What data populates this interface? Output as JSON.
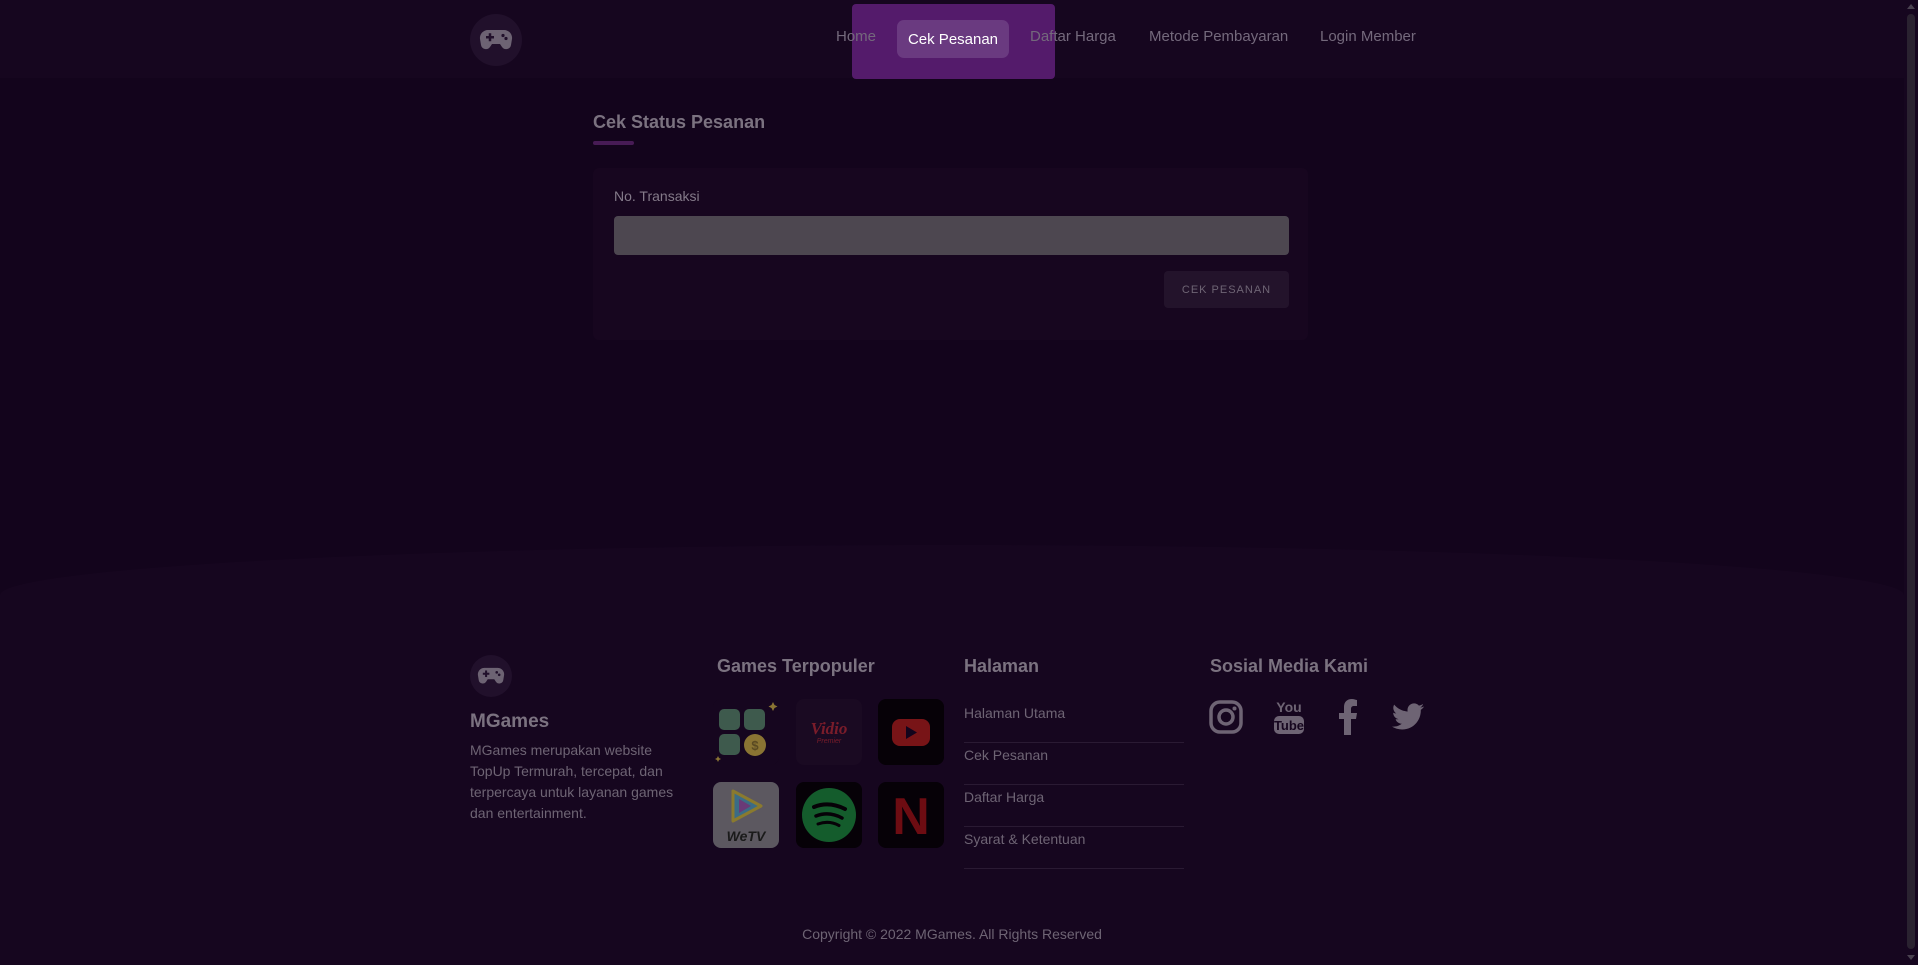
{
  "nav": {
    "logo_icon": "gamepad-icon",
    "items": [
      {
        "label": "Home",
        "active": false
      },
      {
        "label": "Cek Pesanan",
        "active": true
      },
      {
        "label": "Daftar Harga",
        "active": false
      },
      {
        "label": "Metode Pembayaran",
        "active": false
      },
      {
        "label": "Login Member",
        "active": false
      }
    ]
  },
  "main": {
    "title": "Cek Status Pesanan",
    "form": {
      "label": "No. Transaksi",
      "value": "",
      "placeholder": "",
      "button_label": "CEK PESANAN"
    }
  },
  "footer": {
    "brand": {
      "name": "MGames",
      "description": "MGames merupakan website TopUp Termurah, tercepat, dan terpercaya untuk layanan games dan entertainment."
    },
    "games": {
      "title": "Games Terpopuler",
      "tiles": [
        {
          "name": "apps-coins",
          "text": ""
        },
        {
          "name": "vidio-premier",
          "text": "Vidio",
          "subtext": "Premier"
        },
        {
          "name": "youtube",
          "text": ""
        },
        {
          "name": "wetv",
          "text": "WeTV"
        },
        {
          "name": "spotify",
          "text": ""
        },
        {
          "name": "netflix",
          "text": "N"
        }
      ]
    },
    "pages": {
      "title": "Halaman",
      "links": [
        "Halaman Utama",
        "Cek Pesanan",
        "Daftar Harga",
        "Syarat & Ketentuan"
      ]
    },
    "social": {
      "title": "Sosial Media Kami",
      "icons": [
        "instagram-icon",
        "youtube-icon",
        "facebook-icon",
        "twitter-icon"
      ],
      "youtube_text": {
        "line1": "You",
        "line2": "Tube"
      }
    },
    "copyright": "Copyright © 2022 MGames. All Rights Reserved"
  },
  "colors": {
    "background": "#13041c",
    "accent": "#541b6b",
    "active_pill": "#6a3a80"
  }
}
